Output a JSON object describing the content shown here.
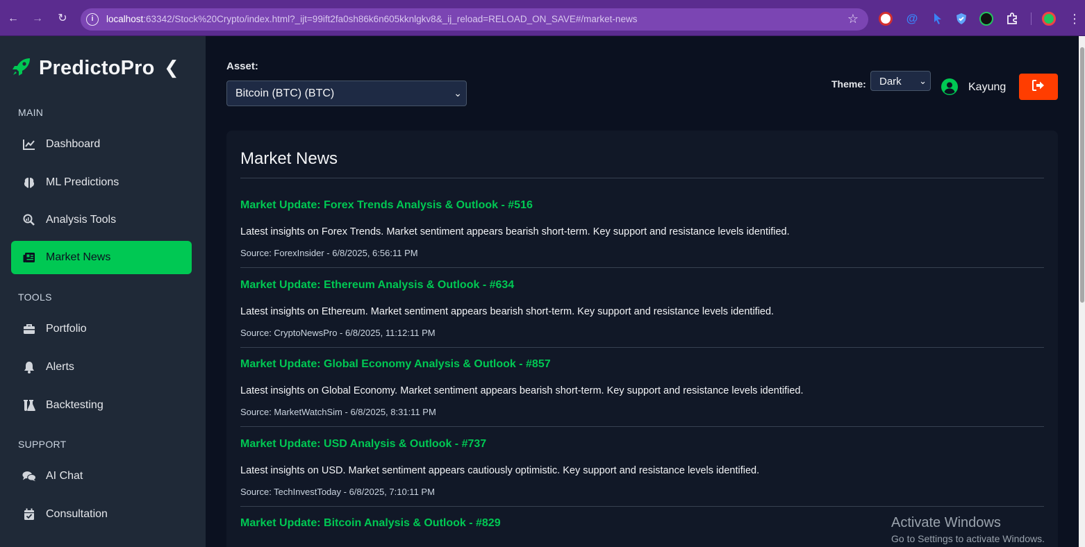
{
  "browser": {
    "url_host": "localhost",
    "url_rest": ":63342/Stock%20Crypto/index.html?_ijt=99ift2fa0sh86k6n605kknlgkv8&_ij_reload=RELOAD_ON_SAVE#/market-news"
  },
  "sidebar": {
    "brand": "PredictoPro",
    "sections": {
      "main": "MAIN",
      "tools": "TOOLS",
      "support": "SUPPORT"
    },
    "items": [
      {
        "label": "Dashboard",
        "icon": "chart-line-icon"
      },
      {
        "label": "ML Predictions",
        "icon": "brain-icon"
      },
      {
        "label": "Analysis Tools",
        "icon": "magnify-chart-icon"
      },
      {
        "label": "Market News",
        "icon": "newspaper-icon",
        "active": true
      },
      {
        "label": "Portfolio",
        "icon": "briefcase-icon"
      },
      {
        "label": "Alerts",
        "icon": "bell-icon"
      },
      {
        "label": "Backtesting",
        "icon": "flask-icon"
      },
      {
        "label": "AI Chat",
        "icon": "chat-icon"
      },
      {
        "label": "Consultation",
        "icon": "calendar-check-icon"
      }
    ]
  },
  "header": {
    "asset_label": "Asset:",
    "asset_value": "Bitcoin (BTC) (BTC)",
    "theme_label": "Theme:",
    "theme_value": "Dark",
    "username": "Kayung"
  },
  "news": {
    "title": "Market News",
    "items": [
      {
        "title": "Market Update: Forex Trends Analysis & Outlook - #516",
        "body": "Latest insights on Forex Trends. Market sentiment appears bearish short-term. Key support and resistance levels identified.",
        "source": "Source: ForexInsider - 6/8/2025, 6:56:11 PM"
      },
      {
        "title": "Market Update: Ethereum Analysis & Outlook - #634",
        "body": "Latest insights on Ethereum. Market sentiment appears bearish short-term. Key support and resistance levels identified.",
        "source": "Source: CryptoNewsPro - 6/8/2025, 11:12:11 PM"
      },
      {
        "title": "Market Update: Global Economy Analysis & Outlook - #857",
        "body": "Latest insights on Global Economy. Market sentiment appears bearish short-term. Key support and resistance levels identified.",
        "source": "Source: MarketWatchSim - 6/8/2025, 8:31:11 PM"
      },
      {
        "title": "Market Update: USD Analysis & Outlook - #737",
        "body": "Latest insights on USD. Market sentiment appears cautiously optimistic. Key support and resistance levels identified.",
        "source": "Source: TechInvestToday - 6/8/2025, 7:10:11 PM"
      },
      {
        "title": "Market Update: Bitcoin Analysis & Outlook - #829",
        "body": "",
        "source": ""
      }
    ]
  },
  "watermark": {
    "line1": "Activate Windows",
    "line2": "Go to Settings to activate Windows."
  },
  "colors": {
    "accent": "#00c853",
    "logout": "#ff3d00",
    "sidebar_bg": "#1f2937",
    "page_bg": "#0b1120",
    "card_bg": "#111827"
  }
}
